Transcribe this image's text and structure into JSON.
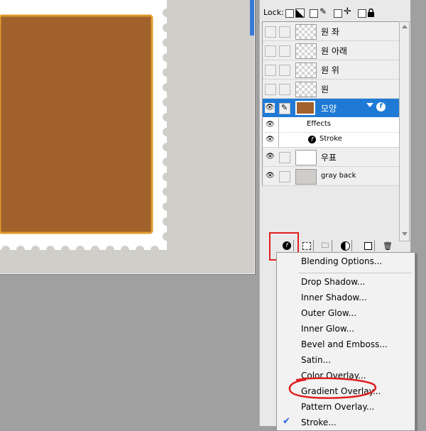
{
  "lock": {
    "label": "Lock:"
  },
  "layers": [
    {
      "name": "원 좌",
      "visible": false
    },
    {
      "name": "원 아래",
      "visible": false
    },
    {
      "name": "원 위",
      "visible": false
    },
    {
      "name": "원",
      "visible": false
    },
    {
      "name": "모양",
      "visible": true,
      "selected": true
    },
    {
      "name": "우표",
      "visible": true
    },
    {
      "name": "gray back",
      "visible": true
    }
  ],
  "effects": {
    "header": "Effects",
    "stroke": "Stroke"
  },
  "menu": {
    "blending_options": "Blending Options...",
    "items": [
      "Drop Shadow...",
      "Inner Shadow...",
      "Outer Glow...",
      "Inner Glow...",
      "Bevel and Emboss...",
      "Satin...",
      "Color Overlay...",
      "Gradient Overlay...",
      "Pattern Overlay...",
      "Stroke..."
    ],
    "checked": "Stroke..."
  },
  "colors": {
    "selection": "#1f7ad6",
    "stamp_fill": "#a0612d",
    "stamp_border": "#e09a2b",
    "annotation": "#e02020"
  }
}
